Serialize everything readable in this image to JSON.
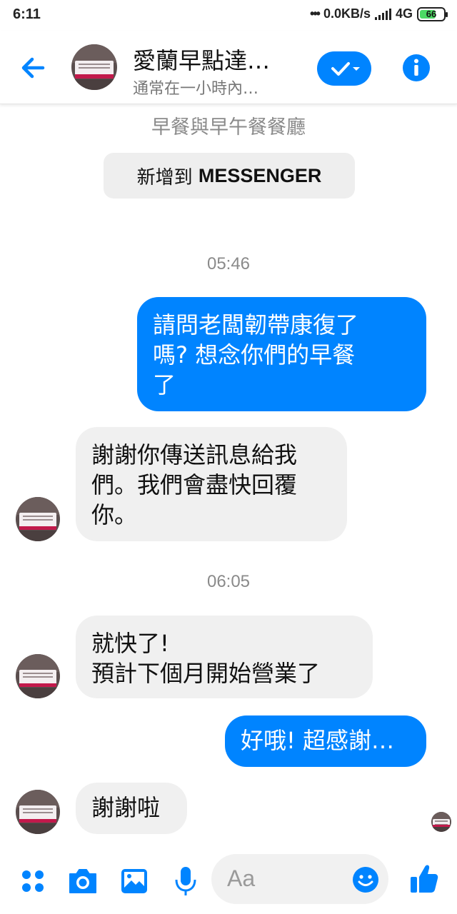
{
  "status_bar": {
    "time": "6:11",
    "network_speed": "0.0KB/s",
    "network_type": "4G",
    "battery": "66"
  },
  "header": {
    "title": "愛蘭早點達…",
    "subtitle": "通常在一小時內…"
  },
  "page_info": {
    "category": "早餐與早午餐餐廳",
    "add_button_prefix": "新增到 ",
    "add_button_brand": "MESSENGER"
  },
  "messages": [
    {
      "type": "timestamp",
      "text": "05:46"
    },
    {
      "type": "outgoing",
      "lines": [
        "請問老闆韌帶康復了",
        "嗎? 想念你們的早餐",
        "了"
      ]
    },
    {
      "type": "incoming",
      "lines": [
        "謝謝你傳送訊息給我",
        "們。我們會盡快回覆",
        "你。"
      ]
    },
    {
      "type": "timestamp",
      "text": "06:05"
    },
    {
      "type": "incoming",
      "lines": [
        "就快了!",
        "預計下個月開始營業了"
      ]
    },
    {
      "type": "outgoing",
      "lines": [
        "好哦! 超感謝…"
      ]
    },
    {
      "type": "incoming",
      "lines": [
        "謝謝啦"
      ]
    }
  ],
  "composer": {
    "placeholder": "Aa"
  },
  "colors": {
    "accent": "#0084ff",
    "incoming_bubble": "#f0f0f0",
    "outgoing_bubble": "#0084ff"
  },
  "icons": [
    "back-arrow-icon",
    "check-dropdown-icon",
    "info-icon",
    "apps-grid-icon",
    "camera-icon",
    "image-icon",
    "microphone-icon",
    "emoji-icon",
    "thumbs-up-icon"
  ]
}
